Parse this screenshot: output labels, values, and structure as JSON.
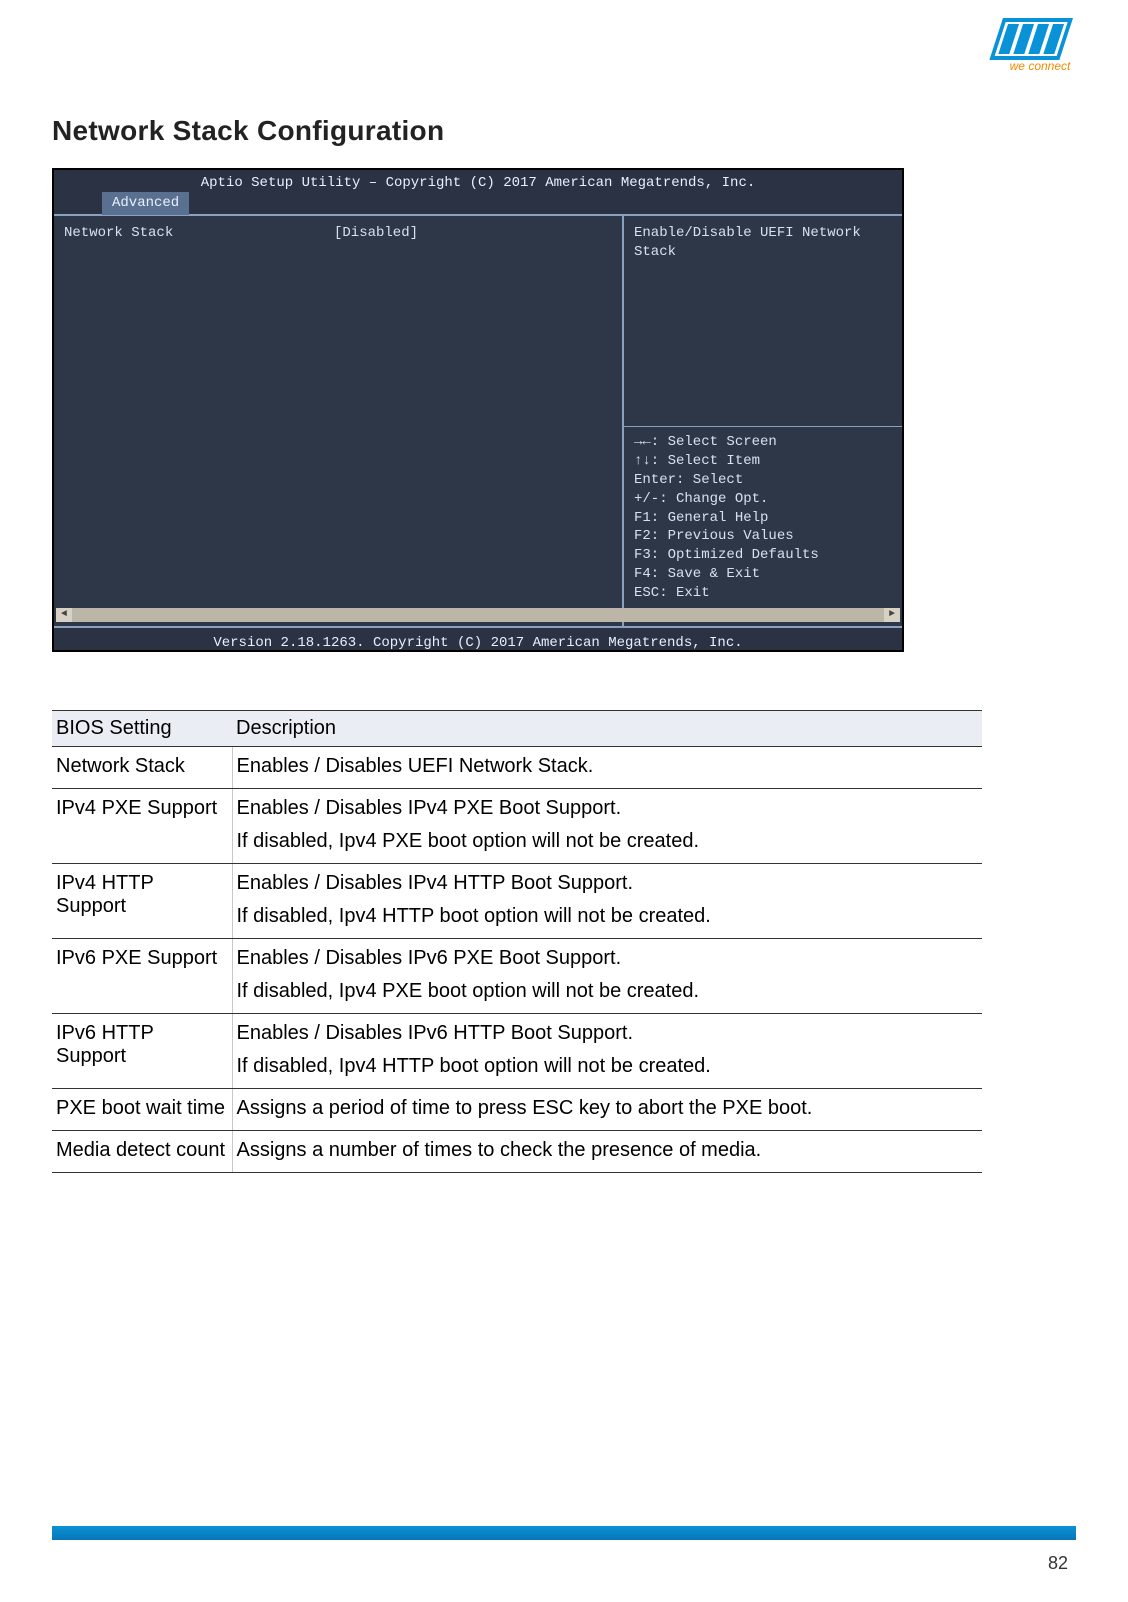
{
  "logo": {
    "tagline": "we connect",
    "brand_color": "#0a92d6"
  },
  "section_title": "Network Stack Configuration",
  "bios": {
    "header": "Aptio Setup Utility – Copyright (C) 2017 American Megatrends, Inc.",
    "tab": "Advanced",
    "setting_label": "Network Stack",
    "setting_value": "[Disabled]",
    "help_text": "Enable/Disable UEFI Network Stack",
    "keys": [
      "→←: Select Screen",
      "↑↓: Select Item",
      "Enter: Select",
      "+/-: Change Opt.",
      "F1: General Help",
      "F2: Previous Values",
      "F3: Optimized Defaults",
      "F4: Save & Exit",
      "ESC: Exit"
    ],
    "footer": "Version 2.18.1263. Copyright (C) 2017 American Megatrends, Inc."
  },
  "table": {
    "header_setting": "BIOS Setting",
    "header_desc": "Description",
    "rows": [
      {
        "setting": "Network Stack",
        "desc1": "Enables / Disables UEFI Network Stack.",
        "desc2": ""
      },
      {
        "setting": "IPv4 PXE Support",
        "desc1": "Enables / Disables IPv4 PXE Boot Support.",
        "desc2": "If disabled, Ipv4 PXE boot option will not be created."
      },
      {
        "setting": "IPv4 HTTP Support",
        "desc1": "Enables / Disables IPv4 HTTP Boot Support.",
        "desc2": "If disabled, Ipv4 HTTP boot option will not be created."
      },
      {
        "setting": "IPv6 PXE Support",
        "desc1": "Enables / Disables IPv6 PXE Boot Support.",
        "desc2": "If disabled, Ipv4 PXE boot option will not be created."
      },
      {
        "setting": "IPv6 HTTP Support",
        "desc1": "Enables / Disables IPv6 HTTP Boot Support.",
        "desc2": "If disabled, Ipv4 HTTP boot option will not be created."
      },
      {
        "setting": "PXE boot wait time",
        "desc1": "Assigns a period of time to press ESC key to abort the PXE boot.",
        "desc2": ""
      },
      {
        "setting": "Media detect count",
        "desc1": "Assigns a number of times to check the presence of media.",
        "desc2": ""
      }
    ]
  },
  "page_number": "82"
}
